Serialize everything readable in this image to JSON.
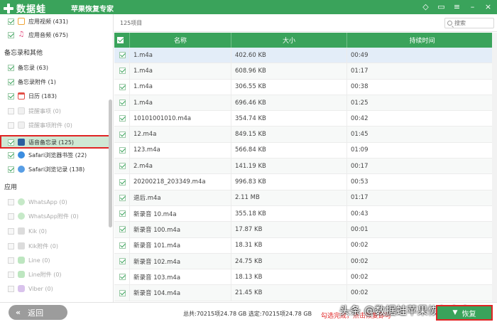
{
  "app": {
    "brand": "数据蛙",
    "subtitle": "苹果恢复专家"
  },
  "titlebar_icons": [
    "diamond-icon",
    "chat-icon",
    "settings-icon",
    "minimize-icon",
    "close-icon"
  ],
  "sidebar": {
    "items_top": [
      {
        "label": "应用视频 (431)",
        "icon": "video-icon",
        "checked": true
      },
      {
        "label": "应用音频 (675)",
        "icon": "music-icon",
        "checked": true
      }
    ],
    "section_memo": "备忘录和其他",
    "items_memo": [
      {
        "label": "备忘录 (63)",
        "icon": "note-icon",
        "checked": true,
        "disabled": false
      },
      {
        "label": "备忘录附件 (1)",
        "icon": "note-attachment-icon",
        "checked": true,
        "disabled": false
      },
      {
        "label": "日历 (183)",
        "icon": "calendar-icon",
        "checked": true,
        "disabled": false
      },
      {
        "label": "提醒事项 (0)",
        "icon": "reminder-icon",
        "checked": false,
        "disabled": true
      },
      {
        "label": "提醒事项附件 (0)",
        "icon": "reminder-attachment-icon",
        "checked": false,
        "disabled": true
      },
      {
        "label": "语音备忘录 (125)",
        "icon": "voice-memo-icon",
        "checked": true,
        "disabled": false,
        "selected": true
      },
      {
        "label": "Safari浏览器书签 (22)",
        "icon": "safari-bookmark-icon",
        "checked": true,
        "disabled": false
      },
      {
        "label": "Safari浏览记录 (138)",
        "icon": "safari-history-icon",
        "checked": true,
        "disabled": false
      }
    ],
    "section_apps": "应用",
    "items_apps": [
      {
        "label": "WhatsApp (0)",
        "icon": "whatsapp-icon"
      },
      {
        "label": "WhatsApp附件 (0)",
        "icon": "whatsapp-attachment-icon"
      },
      {
        "label": "Kik (0)",
        "icon": "kik-icon"
      },
      {
        "label": "Kik附件 (0)",
        "icon": "kik-attachment-icon"
      },
      {
        "label": "Line (0)",
        "icon": "line-icon"
      },
      {
        "label": "Line附件 (0)",
        "icon": "line-attachment-icon"
      },
      {
        "label": "Viber (0)",
        "icon": "viber-icon"
      }
    ]
  },
  "main": {
    "count": "125项目",
    "search_placeholder": "搜索",
    "columns": [
      "名称",
      "大小",
      "持续时间"
    ],
    "rows": [
      {
        "name": "1.m4a",
        "size": "402.60 KB",
        "duration": "00:49"
      },
      {
        "name": "1.m4a",
        "size": "608.96 KB",
        "duration": "01:17"
      },
      {
        "name": "1.m4a",
        "size": "306.55 KB",
        "duration": "00:38"
      },
      {
        "name": "1.m4a",
        "size": "696.46 KB",
        "duration": "01:25"
      },
      {
        "name": "10101001010.m4a",
        "size": "354.74 KB",
        "duration": "00:42"
      },
      {
        "name": "12.m4a",
        "size": "849.15 KB",
        "duration": "01:45"
      },
      {
        "name": "123.m4a",
        "size": "566.84 KB",
        "duration": "01:09"
      },
      {
        "name": "2.m4a",
        "size": "141.19 KB",
        "duration": "00:17"
      },
      {
        "name": "20200218_203349.m4a",
        "size": "996.83 KB",
        "duration": "00:53"
      },
      {
        "name": "退后.m4a",
        "size": "2.11 MB",
        "duration": "01:17"
      },
      {
        "name": "新录音 10.m4a",
        "size": "355.18 KB",
        "duration": "00:43"
      },
      {
        "name": "新录音 100.m4a",
        "size": "17.87 KB",
        "duration": "00:01"
      },
      {
        "name": "新录音 101.m4a",
        "size": "18.31 KB",
        "duration": "00:02"
      },
      {
        "name": "新录音 102.m4a",
        "size": "24.75 KB",
        "duration": "00:02"
      },
      {
        "name": "新录音 103.m4a",
        "size": "18.13 KB",
        "duration": "00:02"
      },
      {
        "name": "新录音 104.m4a",
        "size": "21.45 KB",
        "duration": "00:02"
      }
    ]
  },
  "bottom": {
    "back_label": "返回",
    "totals": "总共:70215项24.78 GB 选定:70215项24.78 GB",
    "note": "勾选完成，点击恢复即可",
    "watermark": "头条 @数据蛙苹果恢复专家",
    "recover_label": "恢复"
  },
  "colors": {
    "accent": "#3aa35b",
    "highlight": "#e02424",
    "row_active": "#e3edf8"
  }
}
